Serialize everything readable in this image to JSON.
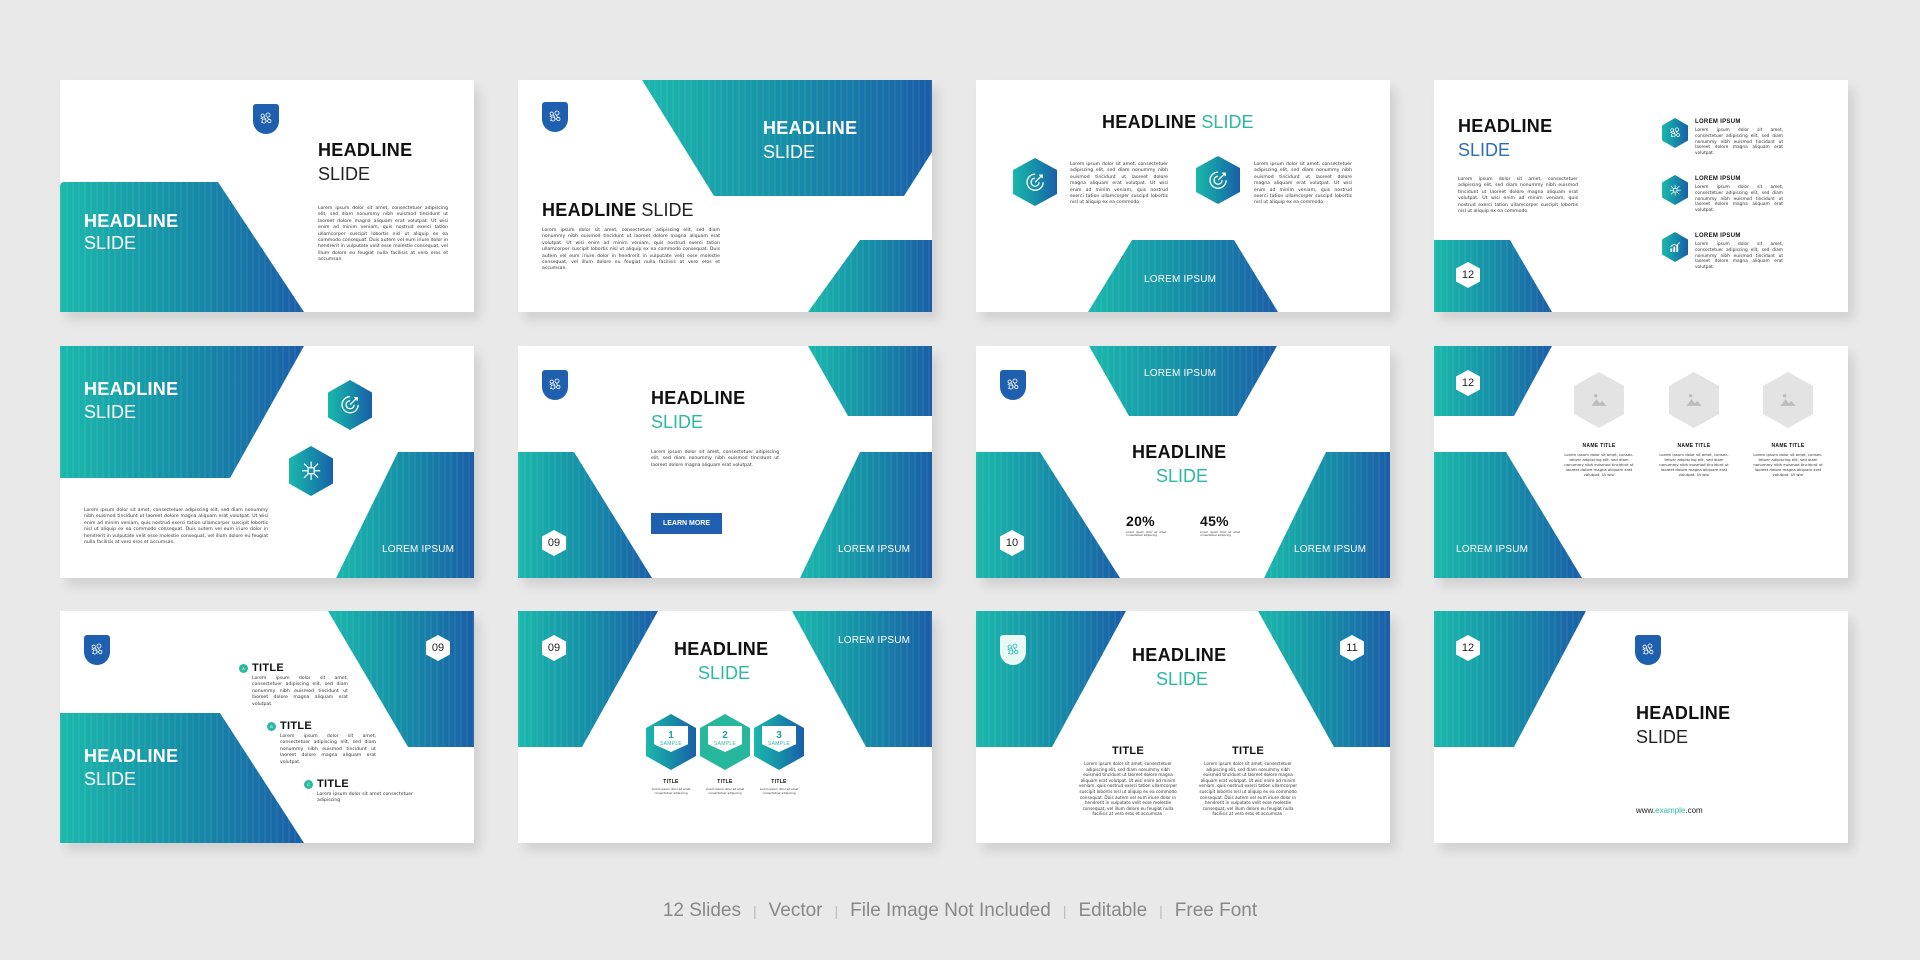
{
  "colors": {
    "teal": "#1bb8ac",
    "blue": "#1a5ea8",
    "shield": "#1f5fb0",
    "background": "#e9e9e9",
    "accent_text": "#2bb9a0"
  },
  "lorem": {
    "long": "Lorem ipsum dolor sit amet, consectetuer adipiscing elit, sed diam nonummy nibh euismod tincidunt ut laoreet dolore magna aliquam erat volutpat. Ut wisi enim ad minim veniam, quis nostrud exerci tation ullamcorper suscipit lobortis nisl ut aliquip ex ea commodo consequat. Duis autem vel eum iriure dolor in hendrerit in vulputate velit esse molestie consequat, vel illum dolore eu feugiat nulla facilisis at vero eros et accumsan.",
    "medium": "Lorem ipsum dolor sit amet, consectetuer adipiscing elit, sed diam nonummy nibh euismod tincidunt ut laoreet dolore magna aliquam erat volutpat. Ut wisi enim ad minim veniam, quis nostrud exerci tation ullamcorper suscipit lobortis nisl ut aliquip ex ea commodo",
    "short": "Lorem ipsum dolor sit amet, consectetuer adipiscing elit, sed diam nonummy nibh euismod tincidunt ut laoreet dolore magna aliquam erat volutpat.",
    "tiny": "Lorem ipsum dolor sit amet, consec- tetuer adipiscing elit, sed diam nonummy nibh euismod tincidunt ut laoreet dolore magna aliquam erat volutpat. Ut wisi",
    "micro": "Lorem ipsum dolor sit amet consectetuer adipiscing"
  },
  "slides": [
    {
      "headline": "HEADLINE",
      "sub": "SLIDE"
    },
    {
      "headline": "HEADLINE",
      "sub": "SLIDE"
    },
    {
      "headline": "HEADLINE",
      "sub": "SLIDE",
      "label": "LOREM IPSUM"
    },
    {
      "headline": "HEADLINE",
      "sub": "SLIDE",
      "page": "12",
      "items": [
        {
          "title": "LOREM IPSUM",
          "icon": "target-icon"
        },
        {
          "title": "LOREM IPSUM",
          "icon": "network-icon"
        },
        {
          "title": "LOREM IPSUM",
          "icon": "growth-chart-icon"
        }
      ]
    },
    {
      "headline": "HEADLINE",
      "sub": "SLIDE",
      "label": "LOREM IPSUM"
    },
    {
      "headline": "HEADLINE",
      "sub": "SLIDE",
      "page": "09",
      "button": "LEARN MORE",
      "label": "LOREM IPSUM"
    },
    {
      "headline": "HEADLINE",
      "sub": "SLIDE",
      "page": "10",
      "label_top": "LOREM IPSUM",
      "label": "LOREM IPSUM",
      "stats": [
        {
          "value": "20%"
        },
        {
          "value": "45%"
        }
      ]
    },
    {
      "page": "12",
      "label": "LOREM IPSUM",
      "people": [
        {
          "name": "NAME TITLE"
        },
        {
          "name": "NAME TITLE"
        },
        {
          "name": "NAME TITLE"
        }
      ]
    },
    {
      "headline": "HEADLINE",
      "sub": "SLIDE",
      "page": "09",
      "items": [
        {
          "letter": "A",
          "title": "TITLE"
        },
        {
          "letter": "B",
          "title": "TITLE"
        },
        {
          "letter": "C",
          "title": "TITLE"
        }
      ]
    },
    {
      "headline": "HEADLINE",
      "sub": "SLIDE",
      "page": "09",
      "label": "LOREM IPSUM",
      "steps": [
        {
          "num": "1",
          "label": "SAMPLE",
          "title": "TITLE"
        },
        {
          "num": "2",
          "label": "SAMPLE",
          "title": "TITLE"
        },
        {
          "num": "3",
          "label": "SAMPLE",
          "title": "TITLE"
        }
      ]
    },
    {
      "headline": "HEADLINE",
      "sub": "SLIDE",
      "page": "11",
      "columns": [
        {
          "title": "TITLE"
        },
        {
          "title": "TITLE"
        }
      ]
    },
    {
      "headline": "HEADLINE",
      "sub": "SLIDE",
      "page": "12",
      "url_prefix": "www.",
      "url_mid": "example",
      "url_suffix": ".com"
    }
  ],
  "footer": {
    "items": [
      "12 Slides",
      "Vector",
      "File Image Not Included",
      "Editable",
      "Free Font"
    ],
    "separator": "|"
  }
}
